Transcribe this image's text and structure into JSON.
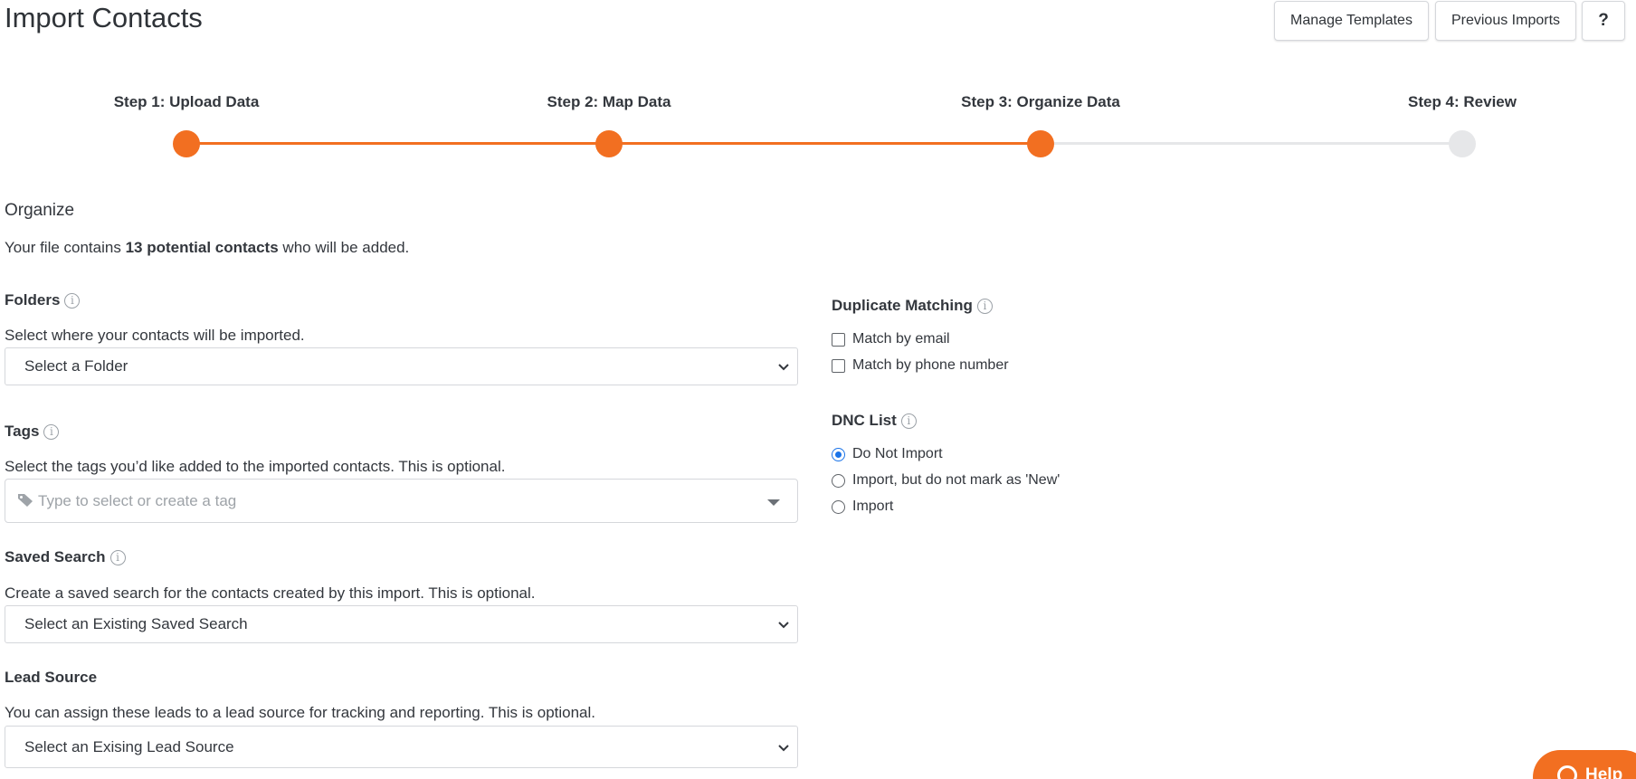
{
  "header": {
    "title": "Import Contacts",
    "buttons": {
      "manage_templates": "Manage Templates",
      "previous_imports": "Previous Imports",
      "help": "?"
    }
  },
  "stepper": {
    "active_color": "#f26f21",
    "inactive_color": "#e6e7e9",
    "current_step": 3,
    "steps": [
      {
        "label": "Step 1: Upload Data",
        "state": "complete"
      },
      {
        "label": "Step 2: Map Data",
        "state": "complete"
      },
      {
        "label": "Step 3: Organize Data",
        "state": "current"
      },
      {
        "label": "Step 4: Review",
        "state": "upcoming"
      }
    ]
  },
  "organize": {
    "title": "Organize",
    "summary_prefix": "Your file contains ",
    "summary_bold": "13 potential contacts",
    "summary_suffix": " who will be added."
  },
  "folders": {
    "label": "Folders",
    "help": "Select where your contacts will be imported.",
    "value": "Select a Folder"
  },
  "tags": {
    "label": "Tags",
    "help": "Select the tags you’d like added to the imported contacts. This is optional.",
    "placeholder": "Type to select or create a tag"
  },
  "saved_search": {
    "label": "Saved Search",
    "help": "Create a saved search for the contacts created by this import. This is optional.",
    "value": "Select an Existing Saved Search"
  },
  "lead_source": {
    "label": "Lead Source",
    "help": "You can assign these leads to a lead source for tracking and reporting. This is optional.",
    "value": "Select an Exising Lead Source"
  },
  "duplicate_matching": {
    "label": "Duplicate Matching",
    "options": [
      {
        "label": "Match by email",
        "checked": false
      },
      {
        "label": "Match by phone number",
        "checked": false
      }
    ]
  },
  "dnc_list": {
    "label": "DNC List",
    "options": [
      {
        "label": "Do Not Import",
        "selected": true
      },
      {
        "label": "Import, but do not mark as 'New'",
        "selected": false
      },
      {
        "label": "Import",
        "selected": false
      }
    ]
  },
  "help_widget": {
    "label": "Help",
    "color": "#f26f21"
  }
}
